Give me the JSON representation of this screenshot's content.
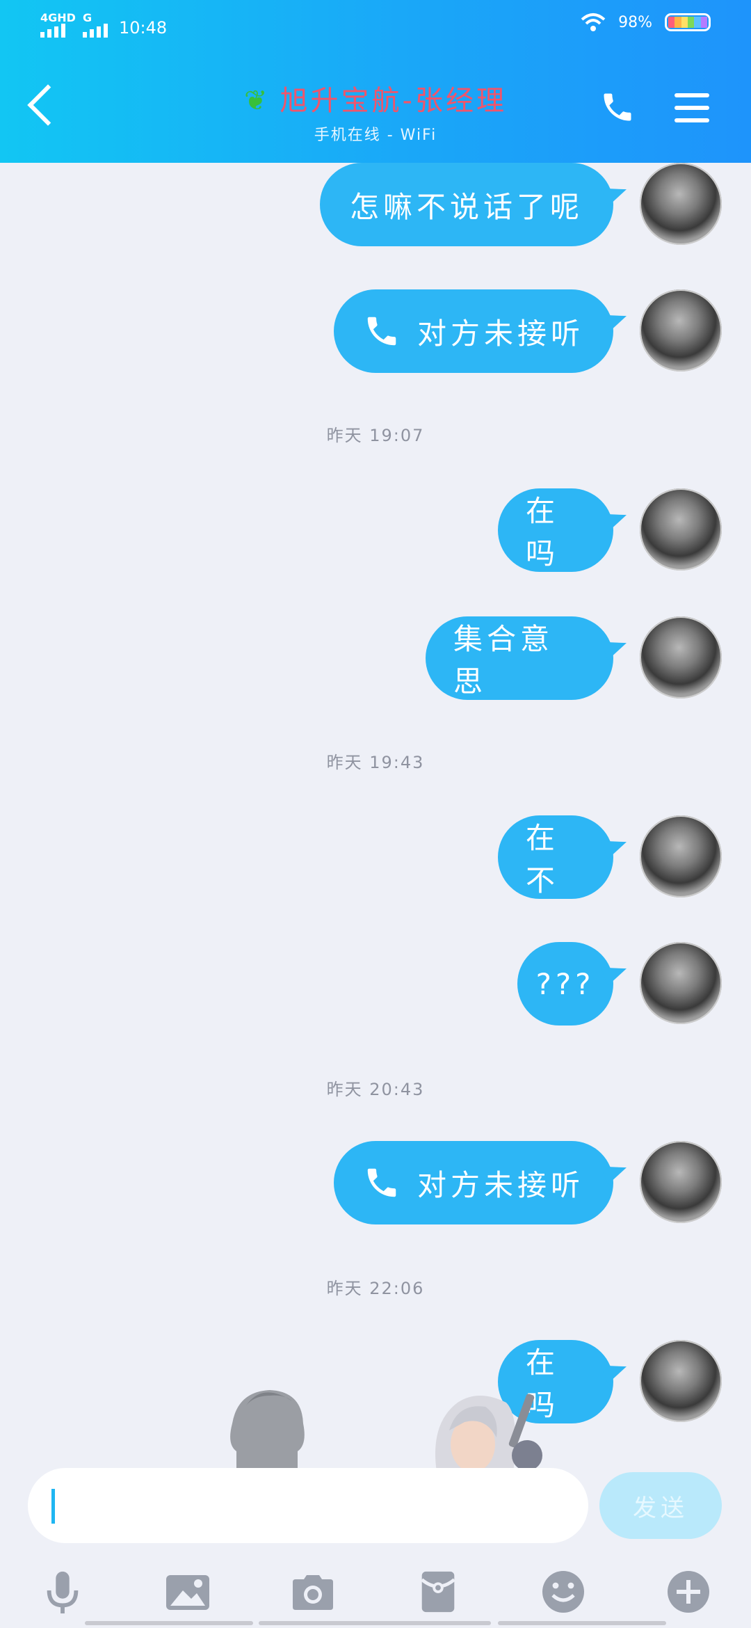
{
  "status_bar": {
    "network": "4GHD",
    "network2": "G",
    "time": "10:48",
    "battery": "98%"
  },
  "header": {
    "title": "旭升宝航-张经理",
    "subtitle": "手机在线 - WiFi",
    "accent": "#1aa7f8"
  },
  "messages": [
    {
      "text": "怎嘛不说话了呢"
    },
    {
      "text": "对方未接听",
      "icon": "phone-icon"
    },
    {
      "time": "昨天 19:07"
    },
    {
      "text": "在吗"
    },
    {
      "text": "集合意思"
    },
    {
      "time": "昨天 19:43"
    },
    {
      "text": "在不"
    },
    {
      "text": "???"
    },
    {
      "time": "昨天 20:43"
    },
    {
      "text": "对方未接听",
      "icon": "phone-icon"
    },
    {
      "time": "昨天 22:06"
    },
    {
      "text": "在吗"
    }
  ],
  "input": {
    "placeholder": "",
    "send_label": "发送"
  },
  "toolbar": [
    "microphone-icon",
    "image-icon",
    "camera-icon",
    "red-packet-icon",
    "emoji-icon",
    "plus-icon"
  ]
}
